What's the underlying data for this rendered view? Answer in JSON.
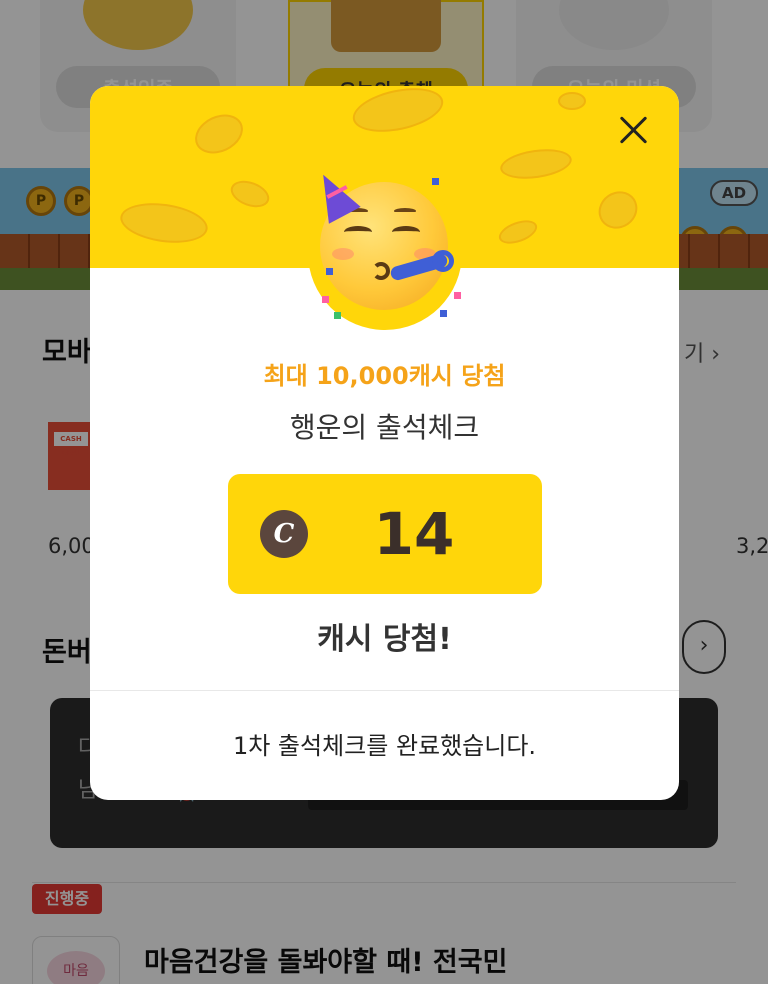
{
  "background": {
    "top_cards": [
      {
        "label": "출석인증"
      },
      {
        "label": "오늘의 출첵"
      },
      {
        "label": "오늘의 미션"
      }
    ],
    "ad_badge": "AD",
    "coin_glyph": "P",
    "section_mobile": {
      "title": "모바",
      "more": "기 ›"
    },
    "product_tag": "CASH DEAL",
    "prices": [
      "6,00",
      "3,2"
    ],
    "section_money": {
      "title": "돈버"
    },
    "arrow_glyph": "›",
    "dark_box_text": [
      "다",
      "남은 시간 ⏰"
    ],
    "in_progress_tag": "진행중",
    "item_thumb_text": "마음",
    "item_title": "마음건강을 돌봐야할 때! 전국민"
  },
  "modal": {
    "subtitle": "최대 10,000캐시 당첨",
    "title": "행운의 출석체크",
    "cash_icon": "C",
    "prize_amount": "14",
    "won_text": "캐시 당첨!",
    "completion_text": "1차 출석체크를 완료했습니다."
  },
  "colors": {
    "accent_yellow": "#ffd60a",
    "subtitle_orange": "#f5a319",
    "cash_icon_brown": "#5b463d"
  }
}
